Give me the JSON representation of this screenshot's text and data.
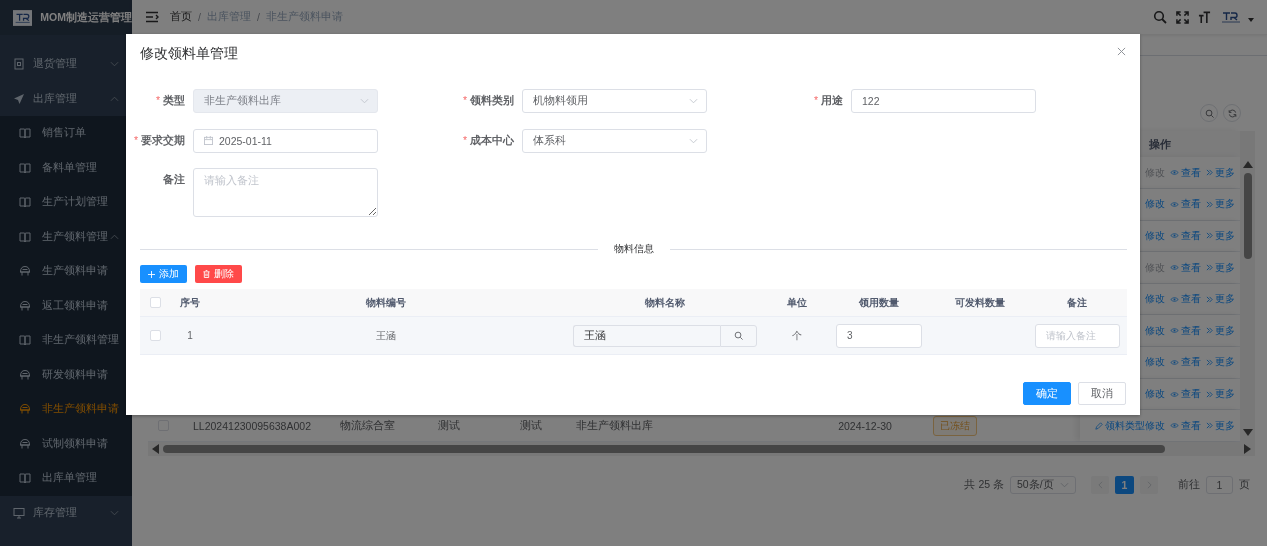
{
  "sidebar": {
    "title": "MOM制造运营管理",
    "items": [
      {
        "label": "退货管理",
        "expanded": false,
        "selected": false
      },
      {
        "label": "出库管理",
        "expanded": true,
        "selected": false,
        "children": [
          {
            "label": "销售订单",
            "selected": false
          },
          {
            "label": "备料单管理",
            "selected": false
          },
          {
            "label": "生产计划管理",
            "selected": false
          },
          {
            "label": "生产领料管理",
            "expanded": true,
            "selected": false,
            "children": [
              {
                "label": "生产领料申请",
                "selected": false
              },
              {
                "label": "返工领料申请",
                "selected": false
              }
            ]
          },
          {
            "label": "非生产领料管理",
            "expanded": true,
            "selected": false,
            "children": [
              {
                "label": "研发领料申请",
                "selected": false
              },
              {
                "label": "非生产领料申请",
                "selected": true
              },
              {
                "label": "试制领料申请",
                "selected": false
              }
            ]
          },
          {
            "label": "出库单管理",
            "selected": false
          }
        ]
      },
      {
        "label": "库存管理",
        "expanded": false,
        "selected": false
      }
    ]
  },
  "header": {
    "separator": "/",
    "breadcrumb": [
      {
        "label": "首页"
      },
      {
        "label": "出库管理"
      },
      {
        "label": "非生产领料申请"
      }
    ]
  },
  "list": {
    "op_header": "操作",
    "rows": [
      {
        "edit": "修改",
        "edit_disabled": true,
        "view": "查看",
        "more": "更多"
      },
      {
        "edit": "修改",
        "edit_disabled": false,
        "view": "查看",
        "more": "更多"
      },
      {
        "edit": "修改",
        "edit_disabled": false,
        "view": "查看",
        "more": "更多"
      },
      {
        "edit": "修改",
        "edit_disabled": true,
        "view": "查看",
        "more": "更多"
      },
      {
        "edit": "修改",
        "edit_disabled": false,
        "view": "查看",
        "more": "更多"
      },
      {
        "edit": "修改",
        "edit_disabled": false,
        "view": "查看",
        "more": "更多"
      },
      {
        "edit": "修改",
        "edit_disabled": false,
        "view": "查看",
        "more": "更多"
      },
      {
        "edit": "修改",
        "edit_disabled": false,
        "view": "查看",
        "more": "更多"
      },
      {
        "cells": [
          "LL20241230095638A002",
          "物流综合室",
          "测试",
          "测试",
          "非生产领料出库",
          "2024-12-30"
        ],
        "status": "已冻结",
        "checked": false,
        "edit": "领料类型修改",
        "edit_disabled": false,
        "view": "查看",
        "more": "更多"
      }
    ],
    "pagination": {
      "total": "共 25 条",
      "page_size": "50条/页",
      "pages": [
        {
          "label": "1",
          "selected": true
        }
      ],
      "goto_label": "前往",
      "goto_value": "1",
      "goto_suffix": "页"
    }
  },
  "dialog": {
    "title": "修改领料单管理",
    "required_mark": "*",
    "form_rows": [
      [
        {
          "label": "类型",
          "required": true,
          "kind": "select",
          "value": "非生产领料出库",
          "disabled": true
        },
        {
          "label": "领料类别",
          "required": true,
          "kind": "select",
          "value": "机物料领用",
          "disabled": false
        },
        {
          "label": "用途",
          "required": true,
          "kind": "input",
          "value": "122",
          "disabled": false
        }
      ],
      [
        {
          "label": "要求交期",
          "required": true,
          "kind": "date",
          "value": "2025-01-11",
          "disabled": false
        },
        {
          "label": "成本中心",
          "required": true,
          "kind": "select",
          "value": "体系科",
          "disabled": false
        }
      ],
      [
        {
          "label": "备注",
          "required": false,
          "kind": "textarea",
          "placeholder": "请输入备注",
          "disabled": false
        }
      ]
    ],
    "section_title": "物料信息",
    "actions": [
      {
        "label": "添加",
        "kind": "add"
      },
      {
        "label": "删除",
        "kind": "delete"
      }
    ],
    "columns": [
      "序号",
      "物料编号",
      "物料名称",
      "单位",
      "领用数量",
      "可发料数量",
      "备注"
    ],
    "all_checked": false,
    "rows": [
      {
        "checked": false,
        "index": "1",
        "code": "王涵",
        "name": "王涵",
        "unit": "个",
        "quantity": "3",
        "remark_placeholder": "请输入备注"
      }
    ],
    "buttons": [
      {
        "label": "确定",
        "kind": "primary"
      },
      {
        "label": "取消",
        "kind": "default"
      }
    ]
  }
}
